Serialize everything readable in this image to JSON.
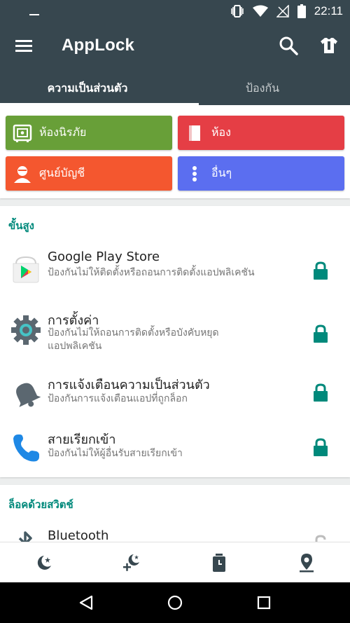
{
  "status_bar": {
    "time": "22:11",
    "icons": [
      "vibrate-icon",
      "wifi-icon",
      "no-signal-icon",
      "battery-icon"
    ]
  },
  "app_bar": {
    "title": "AppLock",
    "icons": [
      "menu-icon",
      "search-icon",
      "theme-icon"
    ]
  },
  "tabs": [
    {
      "label": "ความเป็นส่วนตัว",
      "active": true
    },
    {
      "label": "ป้องกัน",
      "active": false
    }
  ],
  "quick_buttons": {
    "safe": {
      "label": "ห้องนิรภัย",
      "color": "#689f38",
      "icon": "safe-icon"
    },
    "room": {
      "label": "ห้อง",
      "color": "#e53e45",
      "icon": "room-door-icon"
    },
    "account": {
      "label": "ศูนย์บัญชี",
      "color": "#f4572f",
      "icon": "account-icon"
    },
    "other": {
      "label": "อื่นๆ",
      "color": "#5b6ef0",
      "icon": "more-vert-icon"
    }
  },
  "advanced": {
    "title": "ขั้นสูง",
    "items": [
      {
        "title": "Google Play Store",
        "subtitle": "ป้องกันไม่ให้ติดตั้งหรือถอนการติดตั้งแอปพลิเคชัน",
        "icon": "google-play-icon",
        "locked": true
      },
      {
        "title": "การตั้งค่า",
        "subtitle": "ป้องกันไม่ให้ถอนการติดตั้งหรือบังคับหยุดแอปพลิเคชัน",
        "icon": "settings-gear-icon",
        "locked": true
      },
      {
        "title": "การแจ้งเตือนความเป็นส่วนตัว",
        "subtitle": "ป้องกันการแจ้งเตือนแอปที่ถูกล็อก",
        "icon": "bell-icon",
        "locked": true
      },
      {
        "title": "สายเรียกเข้า",
        "subtitle": "ป้องกันไม่ให้ผู้อื่นรับสายเรียกเข้า",
        "icon": "phone-icon",
        "locked": true
      }
    ]
  },
  "switch_lock": {
    "title": "ล็อคด้วยสวิตช์",
    "items": [
      {
        "title": "Bluetooth",
        "icon": "bluetooth-icon",
        "locked": false
      }
    ]
  },
  "bottom_nav": [
    "night-mode-icon",
    "add-night-icon",
    "timer-icon",
    "location-icon"
  ],
  "system_nav": [
    "back-icon",
    "home-icon",
    "recents-icon"
  ],
  "colors": {
    "appbar": "#37474f",
    "accent": "#00897b",
    "lock": "#00897b"
  }
}
